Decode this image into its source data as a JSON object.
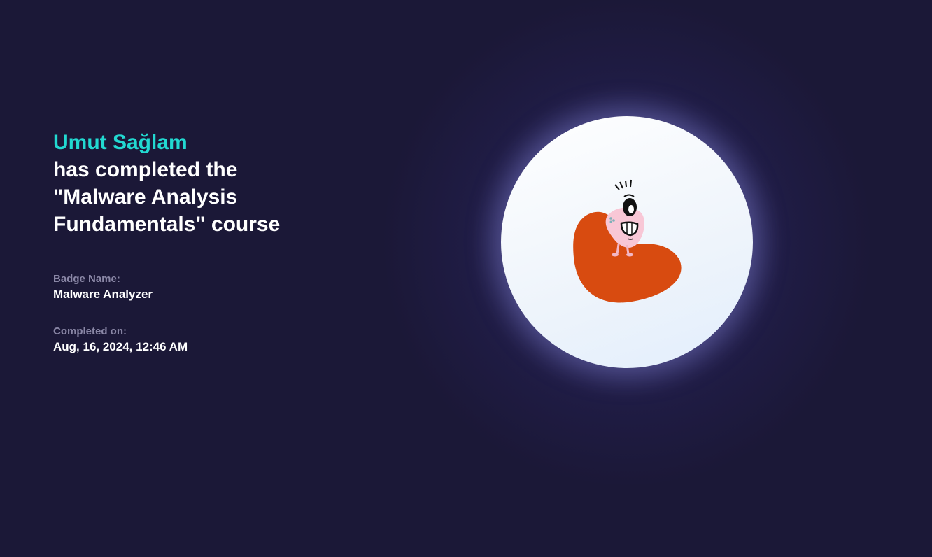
{
  "certificate": {
    "recipient_name": "Umut Sağlam",
    "completion_text_line1": "has completed the",
    "completion_text_line2": "\"Malware Analysis",
    "completion_text_line3": "Fundamentals\" course",
    "badge_name_label": "Badge Name:",
    "badge_name_value": "Malware Analyzer",
    "completed_on_label": "Completed on:",
    "completed_on_value": "Aug, 16, 2024, 12:46 AM"
  },
  "colors": {
    "accent": "#22d9d1",
    "background": "#1b1837",
    "blob": "#d84b10",
    "character": "#f8c7d6"
  }
}
